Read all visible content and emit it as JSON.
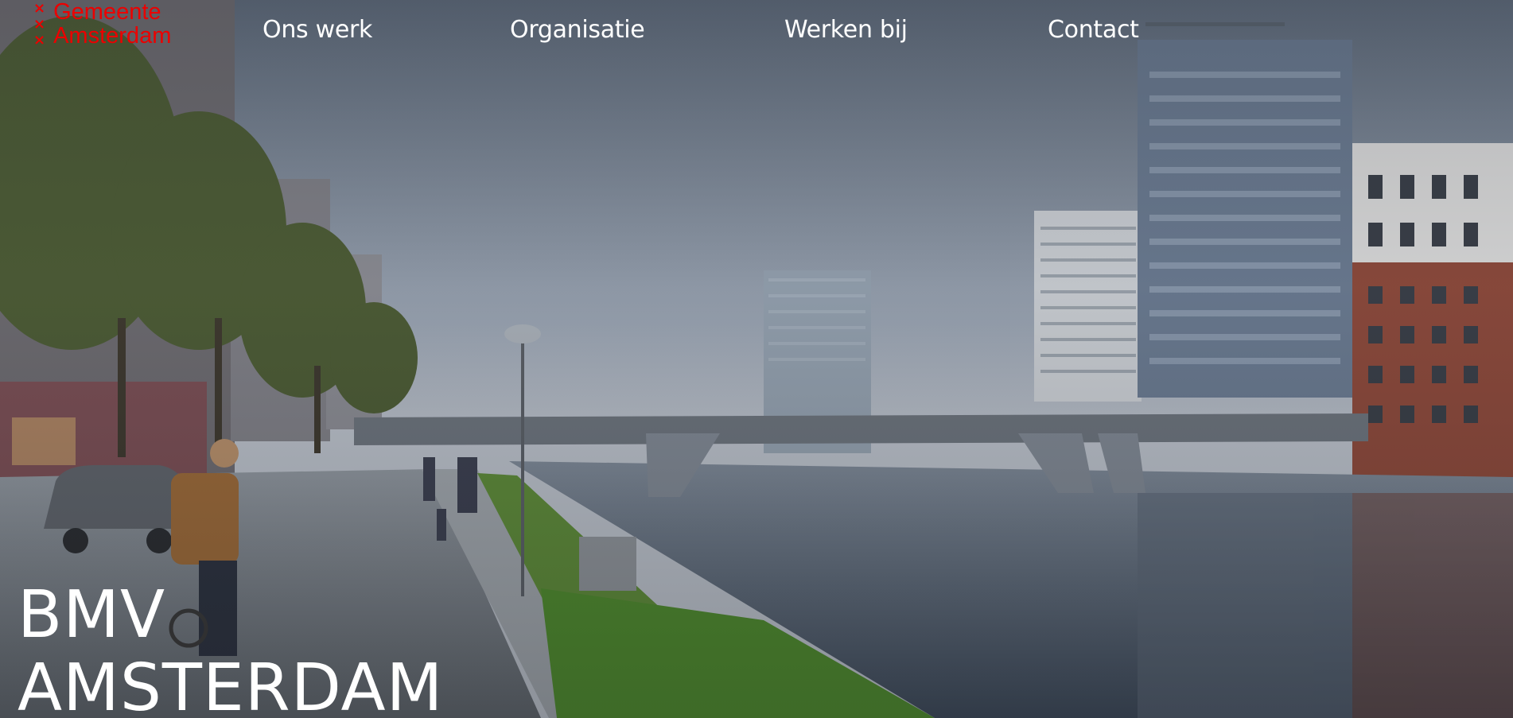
{
  "brand": {
    "crosses": [
      "×",
      "×",
      "×"
    ],
    "line1": "Gemeente",
    "line2": "Amsterdam",
    "color": "#ec0000"
  },
  "nav": {
    "items": [
      {
        "label": "Ons werk"
      },
      {
        "label": "Organisatie"
      },
      {
        "label": "Werken bij"
      },
      {
        "label": "Contact"
      }
    ]
  },
  "hero": {
    "title_line1": "BMV",
    "title_line2": "AMSTERDAM",
    "image_description_icon": "canal-bridge-photo"
  }
}
